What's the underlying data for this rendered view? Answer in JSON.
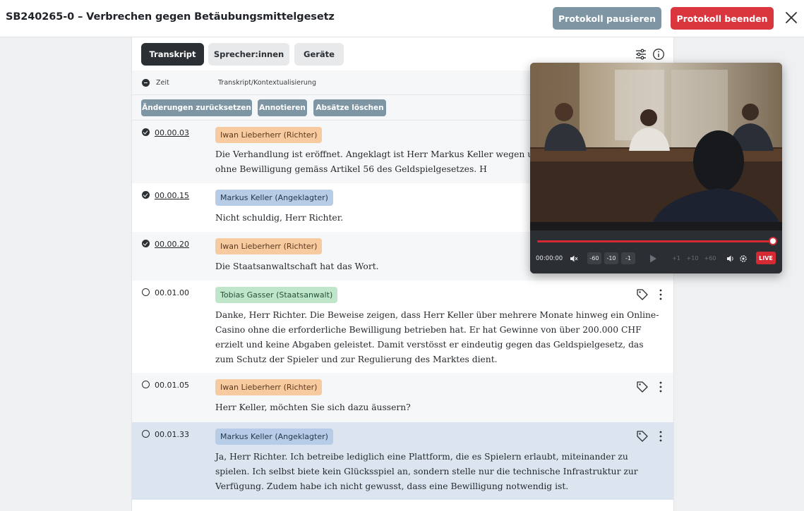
{
  "header": {
    "title": "SB240265-0 – Verbrechen gegen Betäubungsmittelgesetz",
    "pause_label": "Protokoll pausieren",
    "end_label": "Protokoll beenden"
  },
  "tabs": [
    {
      "label": "Transkript",
      "active": true
    },
    {
      "label": "Sprecher:innen",
      "active": false
    },
    {
      "label": "Geräte",
      "active": false
    }
  ],
  "columns": {
    "time": "Zeit",
    "transcript": "Transkript/Kontextualisierung"
  },
  "actions": [
    "Änderungen zurücksetzen",
    "Annotieren",
    "Absätze löschen"
  ],
  "rows": [
    {
      "time": "00.00.03",
      "speaker": "Iwan Lieberherr (Richter)",
      "status": "done",
      "text": "Die Verhandlung ist eröffnet. Angeklagt ist Herr Markus Keller wegen unerlaubten Glücksspiels ohne Bewilligung gemäss Artikel 56 des Geldspielgesetzes. H"
    },
    {
      "time": "00.00.15",
      "speaker": "Markus Keller (Angeklagter)",
      "status": "done",
      "text": "Nicht schuldig, Herr Richter."
    },
    {
      "time": "00.00.20",
      "speaker": "Iwan Lieberherr (Richter)",
      "status": "done",
      "text": "Die Staatsanwaltschaft hat das Wort."
    },
    {
      "time": "00.01.00",
      "speaker": "Tobias Gasser (Staatsanwalt)",
      "status": "open",
      "text": "Danke, Herr Richter. Die Beweise zeigen, dass Herr Keller über mehrere Monate hinweg ein Online-Casino ohne die erforderliche Bewilligung betrieben hat. Er hat Gewinne von über 200.000 CHF erzielt und keine Abgaben geleistet. Damit verstösst er eindeutig gegen das Geldspielgesetz, das zum Schutz der Spieler und zur Regulierung des Marktes dient."
    },
    {
      "time": "00.01.05",
      "speaker": "Iwan Lieberherr (Richter)",
      "status": "open",
      "text": "Herr Keller, möchten Sie sich dazu äussern?"
    },
    {
      "time": "00.01.33",
      "speaker": "Markus Keller (Angeklagter)",
      "status": "open",
      "text": "Ja, Herr Richter. Ich betreibe lediglich eine Plattform, die es Spielern erlaubt, miteinander zu spielen. Ich selbst biete kein Glücksspiel an, sondern stelle nur die technische Infrastruktur zur Verfügung. Zudem habe ich nicht gewusst, dass eine Bewilligung notwendig ist."
    }
  ],
  "video": {
    "time": "00:00:00",
    "skip_back": [
      "-60",
      "-10",
      "-1"
    ],
    "skip_fwd": [
      "+1",
      "+10",
      "+60"
    ],
    "live_label": "LIVE",
    "progress": 1.0
  },
  "colors": {
    "accent_red": "#d9363e",
    "accent_slate": "#7e95a4",
    "judge": "#f7caa0",
    "accused": "#b7cce6",
    "prosecutor": "#bfe6c9"
  }
}
